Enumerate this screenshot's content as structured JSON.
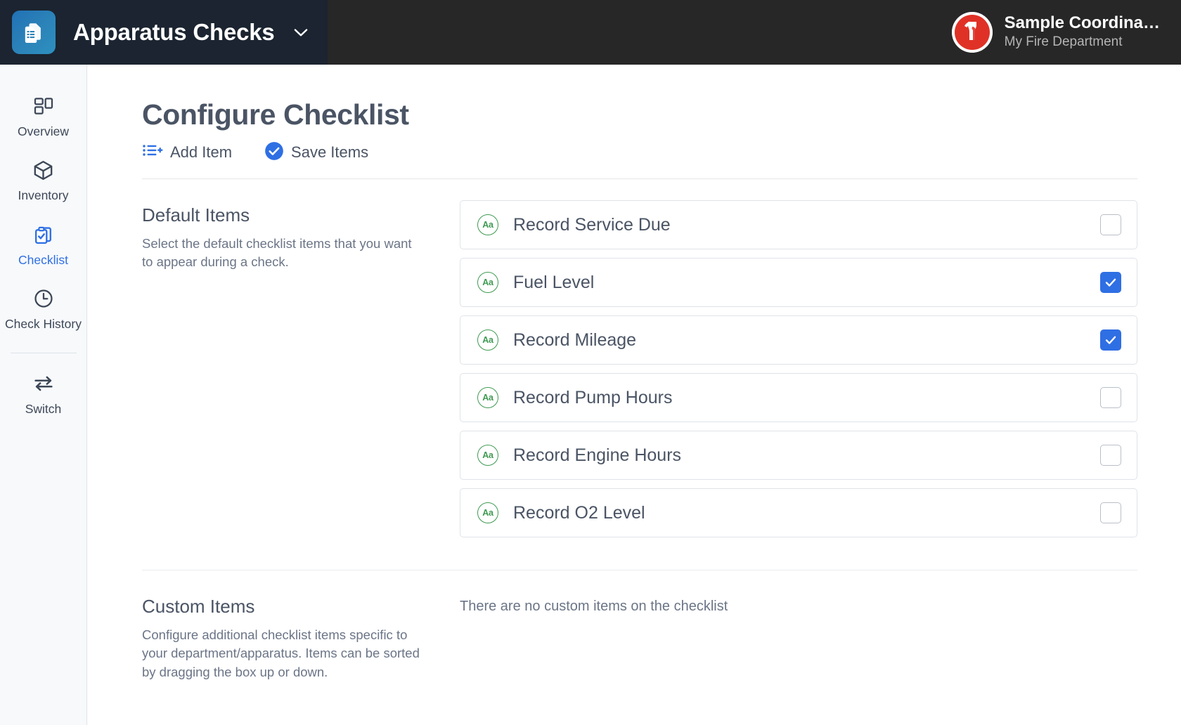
{
  "topbar": {
    "app_icon": "documents-stack-icon",
    "app_title": "Apparatus Checks",
    "app_chevron": "chevron-down-icon",
    "user": {
      "avatar": "fire-department-logo-avatar",
      "name": "Sample Coordina…",
      "org": "My Fire Department"
    },
    "colors": {
      "brand_dark": "#1b2430",
      "bar_dark": "#272727",
      "avatar_red": "#e03127"
    }
  },
  "sidebar": {
    "items": [
      {
        "label": "Overview",
        "icon": "dashboard-layout-icon",
        "active": false,
        "name": "overview"
      },
      {
        "label": "Inventory",
        "icon": "cube-box-icon",
        "active": false,
        "name": "inventory"
      },
      {
        "label": "Checklist",
        "icon": "clipboard-check-icon",
        "active": true,
        "name": "checklist"
      },
      {
        "label": "Check History",
        "icon": "clock-icon",
        "active": false,
        "name": "check-history"
      },
      {
        "label": "Switch",
        "icon": "swap-arrows-icon",
        "active": false,
        "name": "switch"
      }
    ],
    "active_color": "#2f6fe4",
    "idle_color": "#3d4757"
  },
  "main": {
    "page_title": "Configure Checklist",
    "actions": [
      {
        "label": "Add Item",
        "icon": "list-plus-icon",
        "name": "add-item"
      },
      {
        "label": "Save Items",
        "icon": "check-circle-icon",
        "name": "save-items"
      }
    ],
    "default_section": {
      "title": "Default Items",
      "description": "Select the default checklist items that you want to appear during a check.",
      "items": [
        {
          "label": "Record Service Due",
          "badge": "Aa",
          "checked": false
        },
        {
          "label": "Fuel Level",
          "badge": "Aa",
          "checked": true
        },
        {
          "label": "Record Mileage",
          "badge": "Aa",
          "checked": true
        },
        {
          "label": "Record Pump Hours",
          "badge": "Aa",
          "checked": false
        },
        {
          "label": "Record Engine Hours",
          "badge": "Aa",
          "checked": false
        },
        {
          "label": "Record O2 Level",
          "badge": "Aa",
          "checked": false
        }
      ]
    },
    "custom_section": {
      "title": "Custom Items",
      "description": "Configure additional checklist items specific to your department/apparatus. Items can be sorted by dragging the box up or down.",
      "empty_message": "There are no custom items on the checklist"
    }
  }
}
